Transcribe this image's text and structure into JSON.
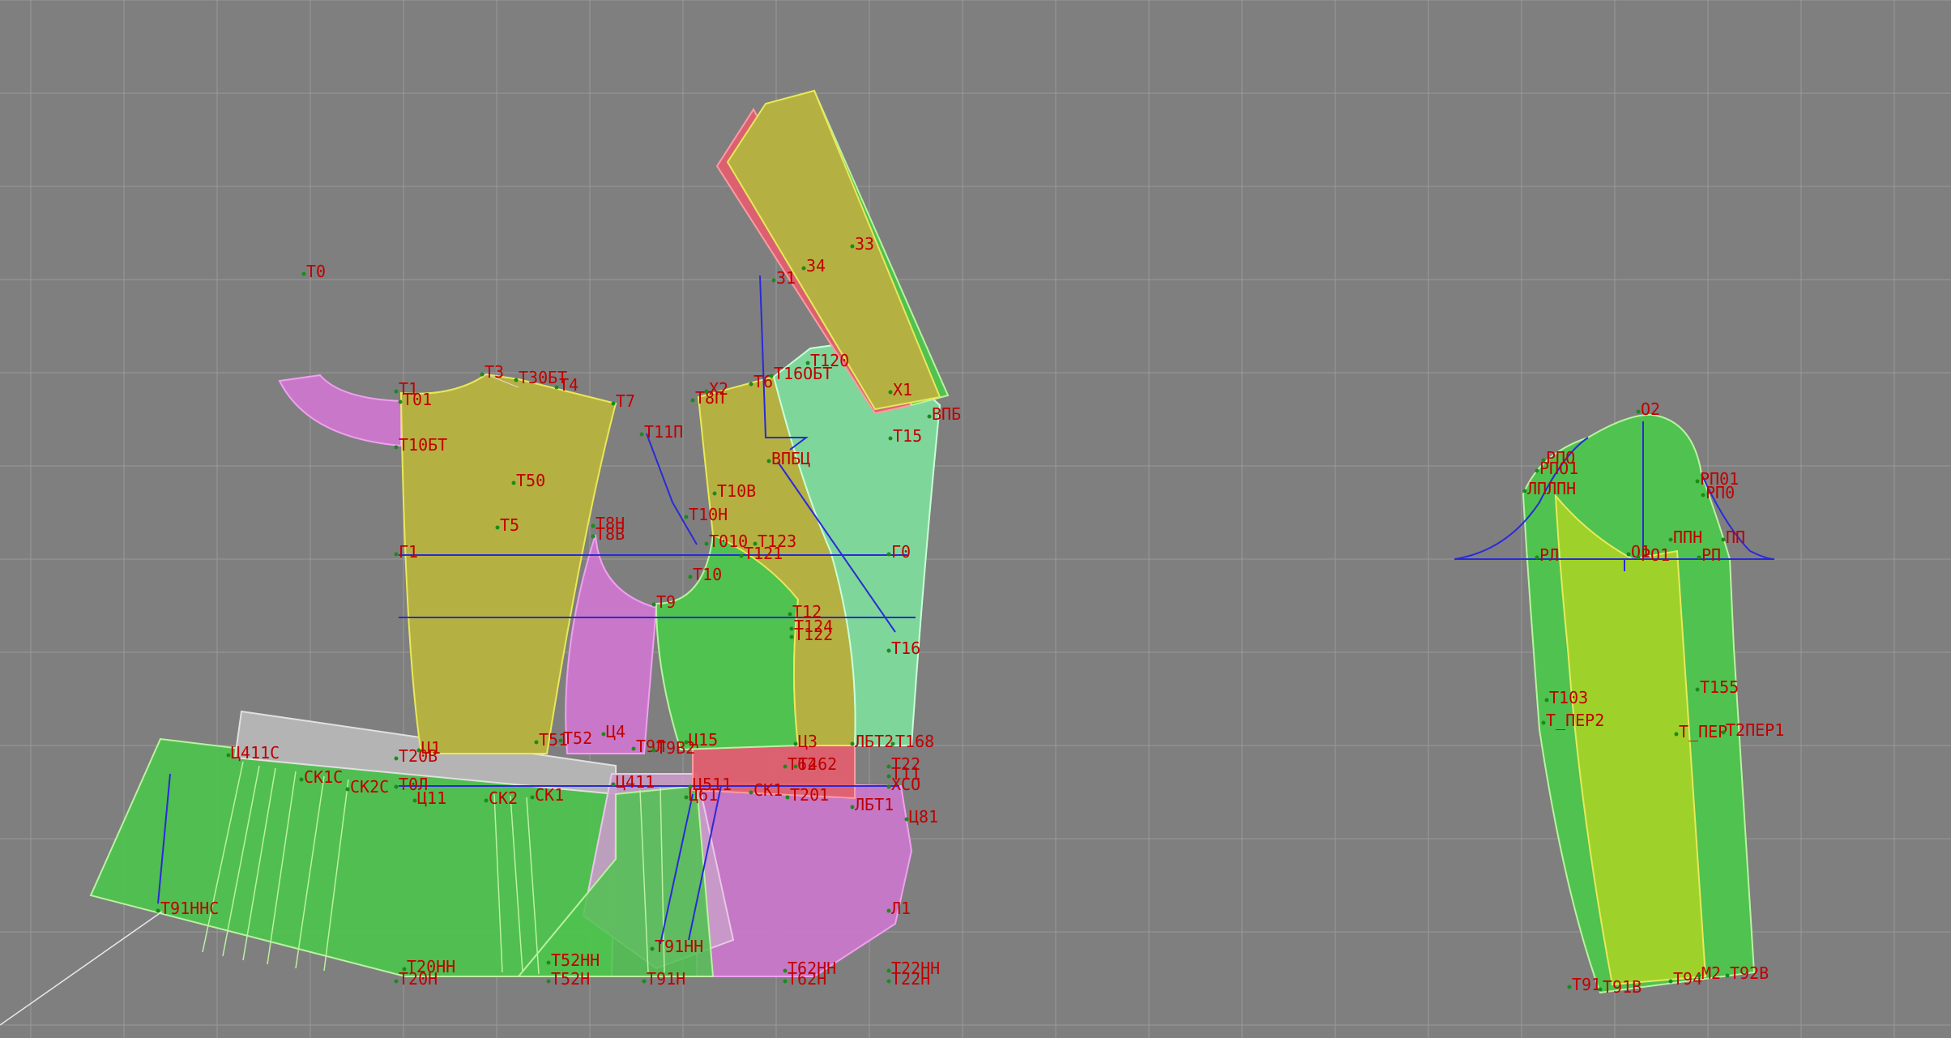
{
  "app": {
    "view": "pattern-drafting-canvas"
  },
  "colors": {
    "background": "#7f7f7f",
    "grid": "#9a9a9a",
    "piece_olive": "#b5b042",
    "piece_green": "#4fc24f",
    "piece_light_green": "#7fd69b",
    "piece_magenta": "#c978c9",
    "piece_red": "#e06070",
    "piece_grey": "#b4b4b4",
    "piece_lime": "#9ed22a",
    "outline": "#e8e85a",
    "guide_line": "#2a2ad8",
    "label": "#c00000",
    "point": "#1a8c1a"
  },
  "labels": {
    "t0": "T0",
    "t1": "T1",
    "t01": "T01",
    "t3": "T3",
    "t30bt": "T30БТ",
    "t4": "T4",
    "t7": "T7",
    "t10bt": "T10БТ",
    "t50": "T50",
    "t5": "T5",
    "g1": "Г1",
    "t8n": "T8Н",
    "t8b": "T8В",
    "t11p": "T11П",
    "x2": "X2",
    "t8p": "T8П",
    "t6": "T6",
    "t16obt": "T16ОБТ",
    "t120": "T120",
    "x1": "X1",
    "vpb": "ВПБ",
    "t15": "T15",
    "vpbc": "ВПБЦ",
    "t10v": "T10В",
    "t10n": "T10Н",
    "t010": "T010",
    "t123": "T123",
    "t121": "T121",
    "g0": "Г0",
    "t10": "T10",
    "t9": "T9",
    "t12": "T12",
    "t124": "T124",
    "t122": "T122",
    "t16": "T16",
    "n33": "33",
    "n34": "34",
    "n31": "31",
    "t411c": "Ц411С",
    "ck1c": "СК1С",
    "ck2c": "СК2С",
    "t2": "T2",
    "t20v": "T20В",
    "t11b": "Ц1",
    "t1ol": "Т0Л",
    "t11": "Ц11",
    "ck2": "СК2",
    "ck1": "СК1",
    "t51": "T51",
    "t52": "T52",
    "t4b": "Ц4",
    "t9l": "T9Л",
    "t9b2": "T9В2",
    "t411": "Ц411",
    "t15b": "Ц15",
    "t511": "Ц511",
    "t161": "Ц61",
    "ck1b": "СК1",
    "t3b": "Ц3",
    "t62": "T62",
    "t462": "T462",
    "t201": "T201",
    "lbt2": "ЛБТ2",
    "t168": "T168",
    "t22": "T22",
    "t11p2": "T11",
    "xco": "ХСО",
    "lbt1": "ЛБТ1",
    "t181": "Ц81",
    "l1": "Л1",
    "t91nnc": "T91ННС",
    "t20nn": "T20НН",
    "t20n": "T20Н",
    "t52nn": "T52НН",
    "t52n": "T52Н",
    "t91nn": "T91НН",
    "t91n": "T91Н",
    "t62nn": "T62НН",
    "t62n": "T62Н",
    "t22nn": "T22НН",
    "t22n": "T22Н",
    "o2": "О2",
    "rpo": "РПО",
    "rpo1": "РПО1",
    "lplpn": "ЛПЛПН",
    "rp01": "РП01",
    "rp0": "РП0",
    "ppn": "ППН",
    "pp": "ПП",
    "rl": "РЛ",
    "o1": "О1",
    "pro1": "РО1",
    "rp": "РП",
    "t103": "T103",
    "t_per2": "Т_ПЕР2",
    "t155": "T155",
    "t_per": "Т_ПЕР",
    "t2per1": "T2ПЕР1",
    "t91": "T91",
    "t91b": "T91В",
    "t94": "T94",
    "m2": "М2",
    "t9b2sl": "T92В"
  }
}
